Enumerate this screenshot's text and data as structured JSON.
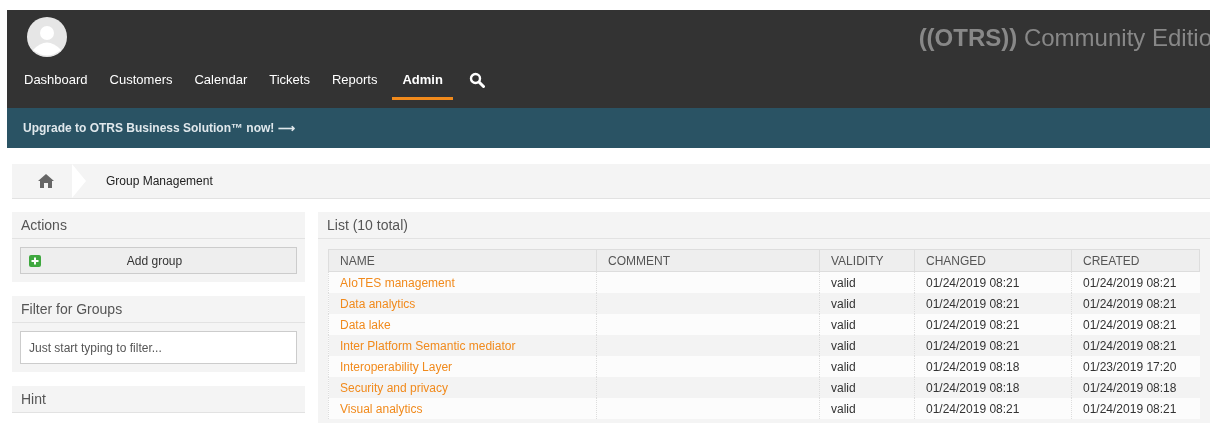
{
  "header": {
    "brand": "**((OTRS))** Community Editio"
  },
  "nav": [
    {
      "label": "Dashboard",
      "selected": false
    },
    {
      "label": "Customers",
      "selected": false
    },
    {
      "label": "Calendar",
      "selected": false
    },
    {
      "label": "Tickets",
      "selected": false
    },
    {
      "label": "Reports",
      "selected": false
    },
    {
      "label": "Admin",
      "selected": true
    }
  ],
  "banner": "Upgrade to OTRS Business Solution™ now! ⟶",
  "breadcrumb": "Group Management",
  "sidebar": {
    "actions_title": "Actions",
    "add_button": "Add group",
    "filter_title": "Filter for Groups",
    "filter_placeholder": "Just start typing to filter...",
    "hint_title": "Hint"
  },
  "list": {
    "title": "List (10 total)",
    "columns": [
      "NAME",
      "COMMENT",
      "VALIDITY",
      "CHANGED",
      "CREATED"
    ],
    "rows": [
      [
        "AIoTES management",
        "",
        "valid",
        "01/24/2019 08:21",
        "01/24/2019 08:21"
      ],
      [
        "Data analytics",
        "",
        "valid",
        "01/24/2019 08:21",
        "01/24/2019 08:21"
      ],
      [
        "Data lake",
        "",
        "valid",
        "01/24/2019 08:21",
        "01/24/2019 08:21"
      ],
      [
        "Inter Platform Semantic mediator",
        "",
        "valid",
        "01/24/2019 08:21",
        "01/24/2019 08:21"
      ],
      [
        "Interoperability Layer",
        "",
        "valid",
        "01/24/2019 08:18",
        "01/23/2019 17:20"
      ],
      [
        "Security and privacy",
        "",
        "valid",
        "01/24/2019 08:18",
        "01/24/2019 08:18"
      ],
      [
        "Visual analytics",
        "",
        "valid",
        "01/24/2019 08:21",
        "01/24/2019 08:21"
      ]
    ]
  }
}
